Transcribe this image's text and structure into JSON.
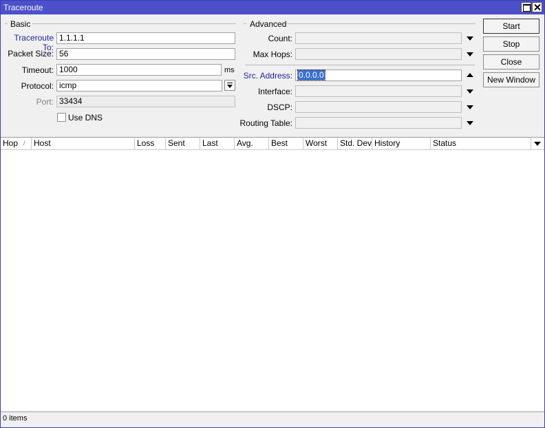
{
  "window": {
    "title": "Traceroute"
  },
  "basic": {
    "group_label": "Basic",
    "traceroute_to": {
      "label": "Traceroute To:",
      "value": "1.1.1.1"
    },
    "packet_size": {
      "label": "Packet Size:",
      "value": "56"
    },
    "timeout": {
      "label": "Timeout:",
      "value": "1000",
      "unit": "ms"
    },
    "protocol": {
      "label": "Protocol:",
      "value": "icmp"
    },
    "port": {
      "label": "Port:",
      "value": "33434"
    },
    "use_dns": {
      "label": "Use DNS",
      "checked": false
    }
  },
  "advanced": {
    "group_label": "Advanced",
    "count": {
      "label": "Count:",
      "value": ""
    },
    "max_hops": {
      "label": "Max Hops:",
      "value": ""
    },
    "src_address": {
      "label": "Src. Address:",
      "value": "0.0.0.0"
    },
    "interface": {
      "label": "Interface:",
      "value": ""
    },
    "dscp": {
      "label": "DSCP:",
      "value": ""
    },
    "routing_table": {
      "label": "Routing Table:",
      "value": ""
    }
  },
  "buttons": {
    "start": "Start",
    "stop": "Stop",
    "close": "Close",
    "new_window": "New Window"
  },
  "table": {
    "columns": [
      "Hop",
      "Host",
      "Loss",
      "Sent",
      "Last",
      "Avg.",
      "Best",
      "Worst",
      "Std. Dev.",
      "History",
      "Status"
    ],
    "sort_indicator": "/",
    "rows": []
  },
  "status_bar": {
    "text": "0 items"
  }
}
